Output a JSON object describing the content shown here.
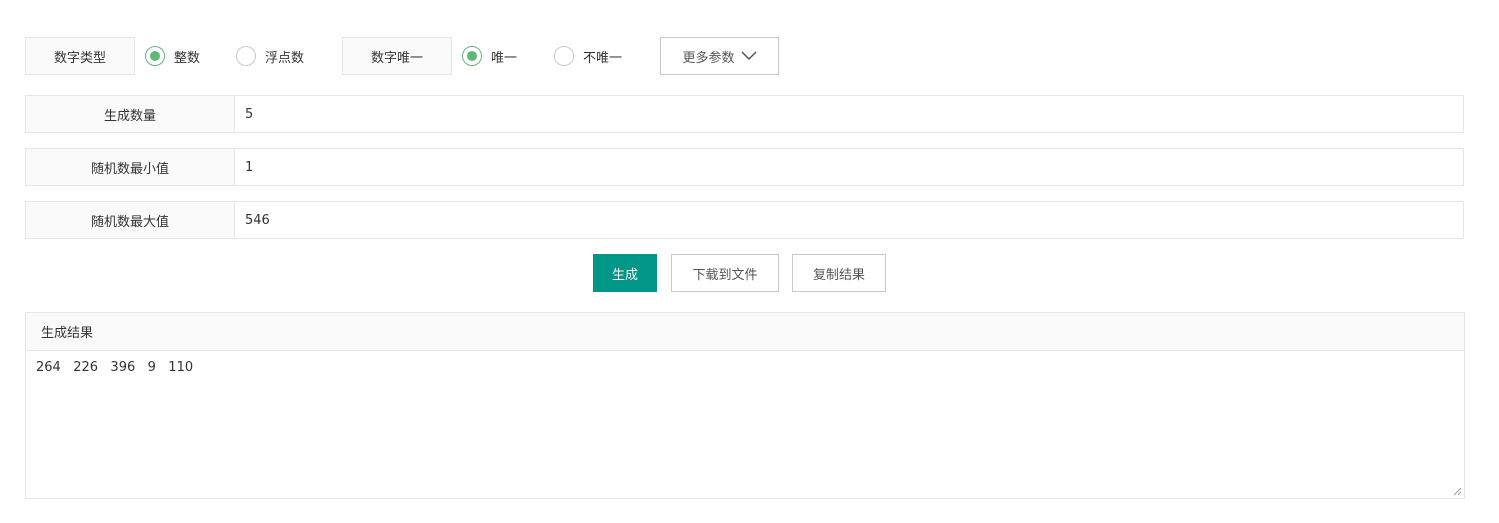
{
  "options": {
    "number_type": {
      "label": "数字类型",
      "choices": [
        {
          "label": "整数",
          "checked": true
        },
        {
          "label": "浮点数",
          "checked": false
        }
      ]
    },
    "uniqueness": {
      "label": "数字唯一",
      "choices": [
        {
          "label": "唯一",
          "checked": true
        },
        {
          "label": "不唯一",
          "checked": false
        }
      ]
    },
    "more_params_label": "更多参数"
  },
  "fields": {
    "count": {
      "label": "生成数量",
      "value": "5"
    },
    "min": {
      "label": "随机数最小值",
      "value": "1"
    },
    "max": {
      "label": "随机数最大值",
      "value": "546"
    }
  },
  "actions": {
    "generate": "生成",
    "download": "下载到文件",
    "copy": "复制结果"
  },
  "result": {
    "title": "生成结果",
    "text": "264   226   396   9   110"
  },
  "colors": {
    "accent": "#009688",
    "radio_checked": "#5fb878"
  }
}
